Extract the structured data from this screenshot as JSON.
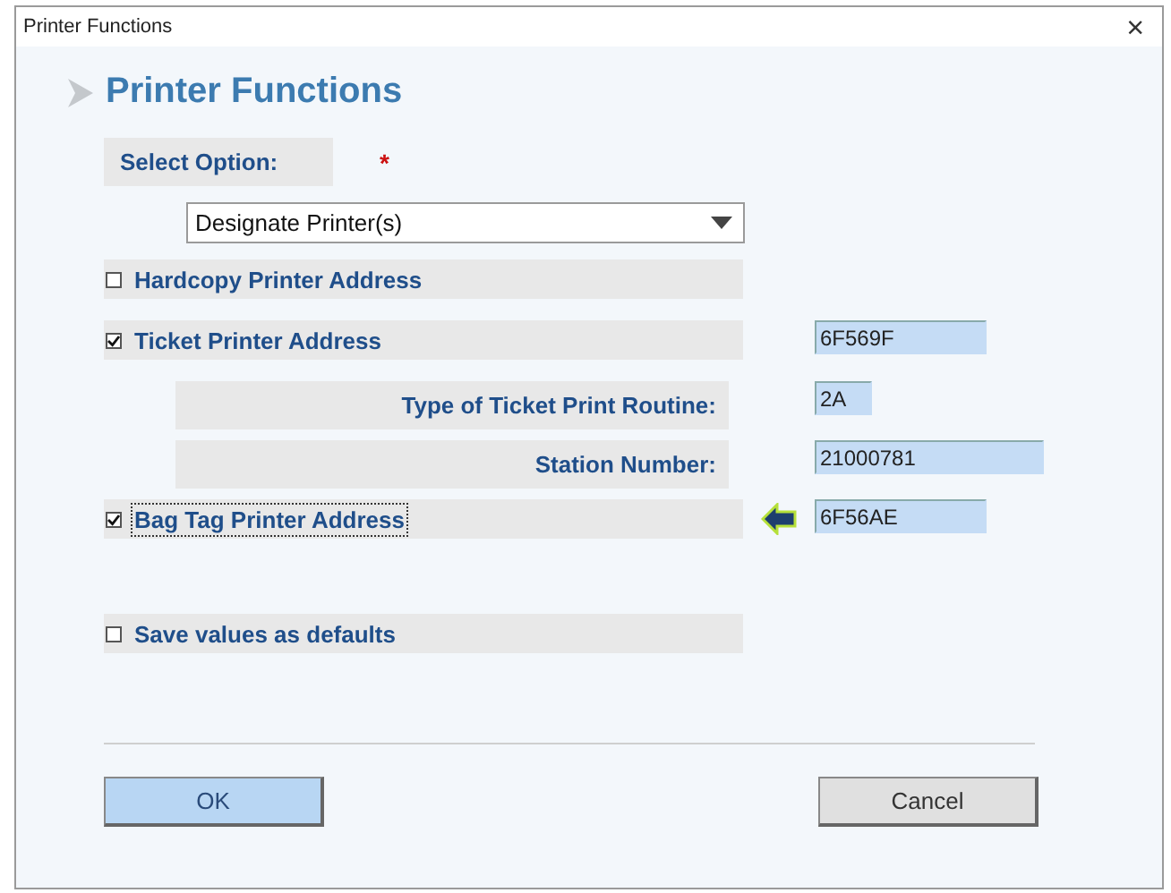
{
  "window": {
    "title": "Printer Functions",
    "close": "×"
  },
  "heading": "Printer Functions",
  "select_option": {
    "label": "Select Option:",
    "required_mark": "*",
    "value": "Designate Printer(s)"
  },
  "rows": [
    {
      "kind": "checkbox",
      "label": "Hardcopy Printer Address",
      "checked": false,
      "focused": false,
      "pointer": false
    },
    {
      "kind": "checkbox",
      "label": "Ticket Printer Address",
      "checked": true,
      "focused": false,
      "pointer": false,
      "value": "6F569F"
    },
    {
      "kind": "sublabel",
      "label": "Type of Ticket Print Routine:",
      "value": "2A"
    },
    {
      "kind": "sublabel",
      "label": "Station Number:",
      "value": "21000781"
    },
    {
      "kind": "checkbox",
      "label": "Bag Tag Printer Address",
      "checked": true,
      "focused": true,
      "pointer": true,
      "value": "6F56AE"
    },
    {
      "kind": "spacer"
    },
    {
      "kind": "checkbox",
      "label": "Save values as defaults",
      "checked": false,
      "focused": false,
      "pointer": false
    }
  ],
  "buttons": [
    {
      "label": "OK",
      "default": true
    },
    {
      "label": "Cancel",
      "default": false
    }
  ]
}
